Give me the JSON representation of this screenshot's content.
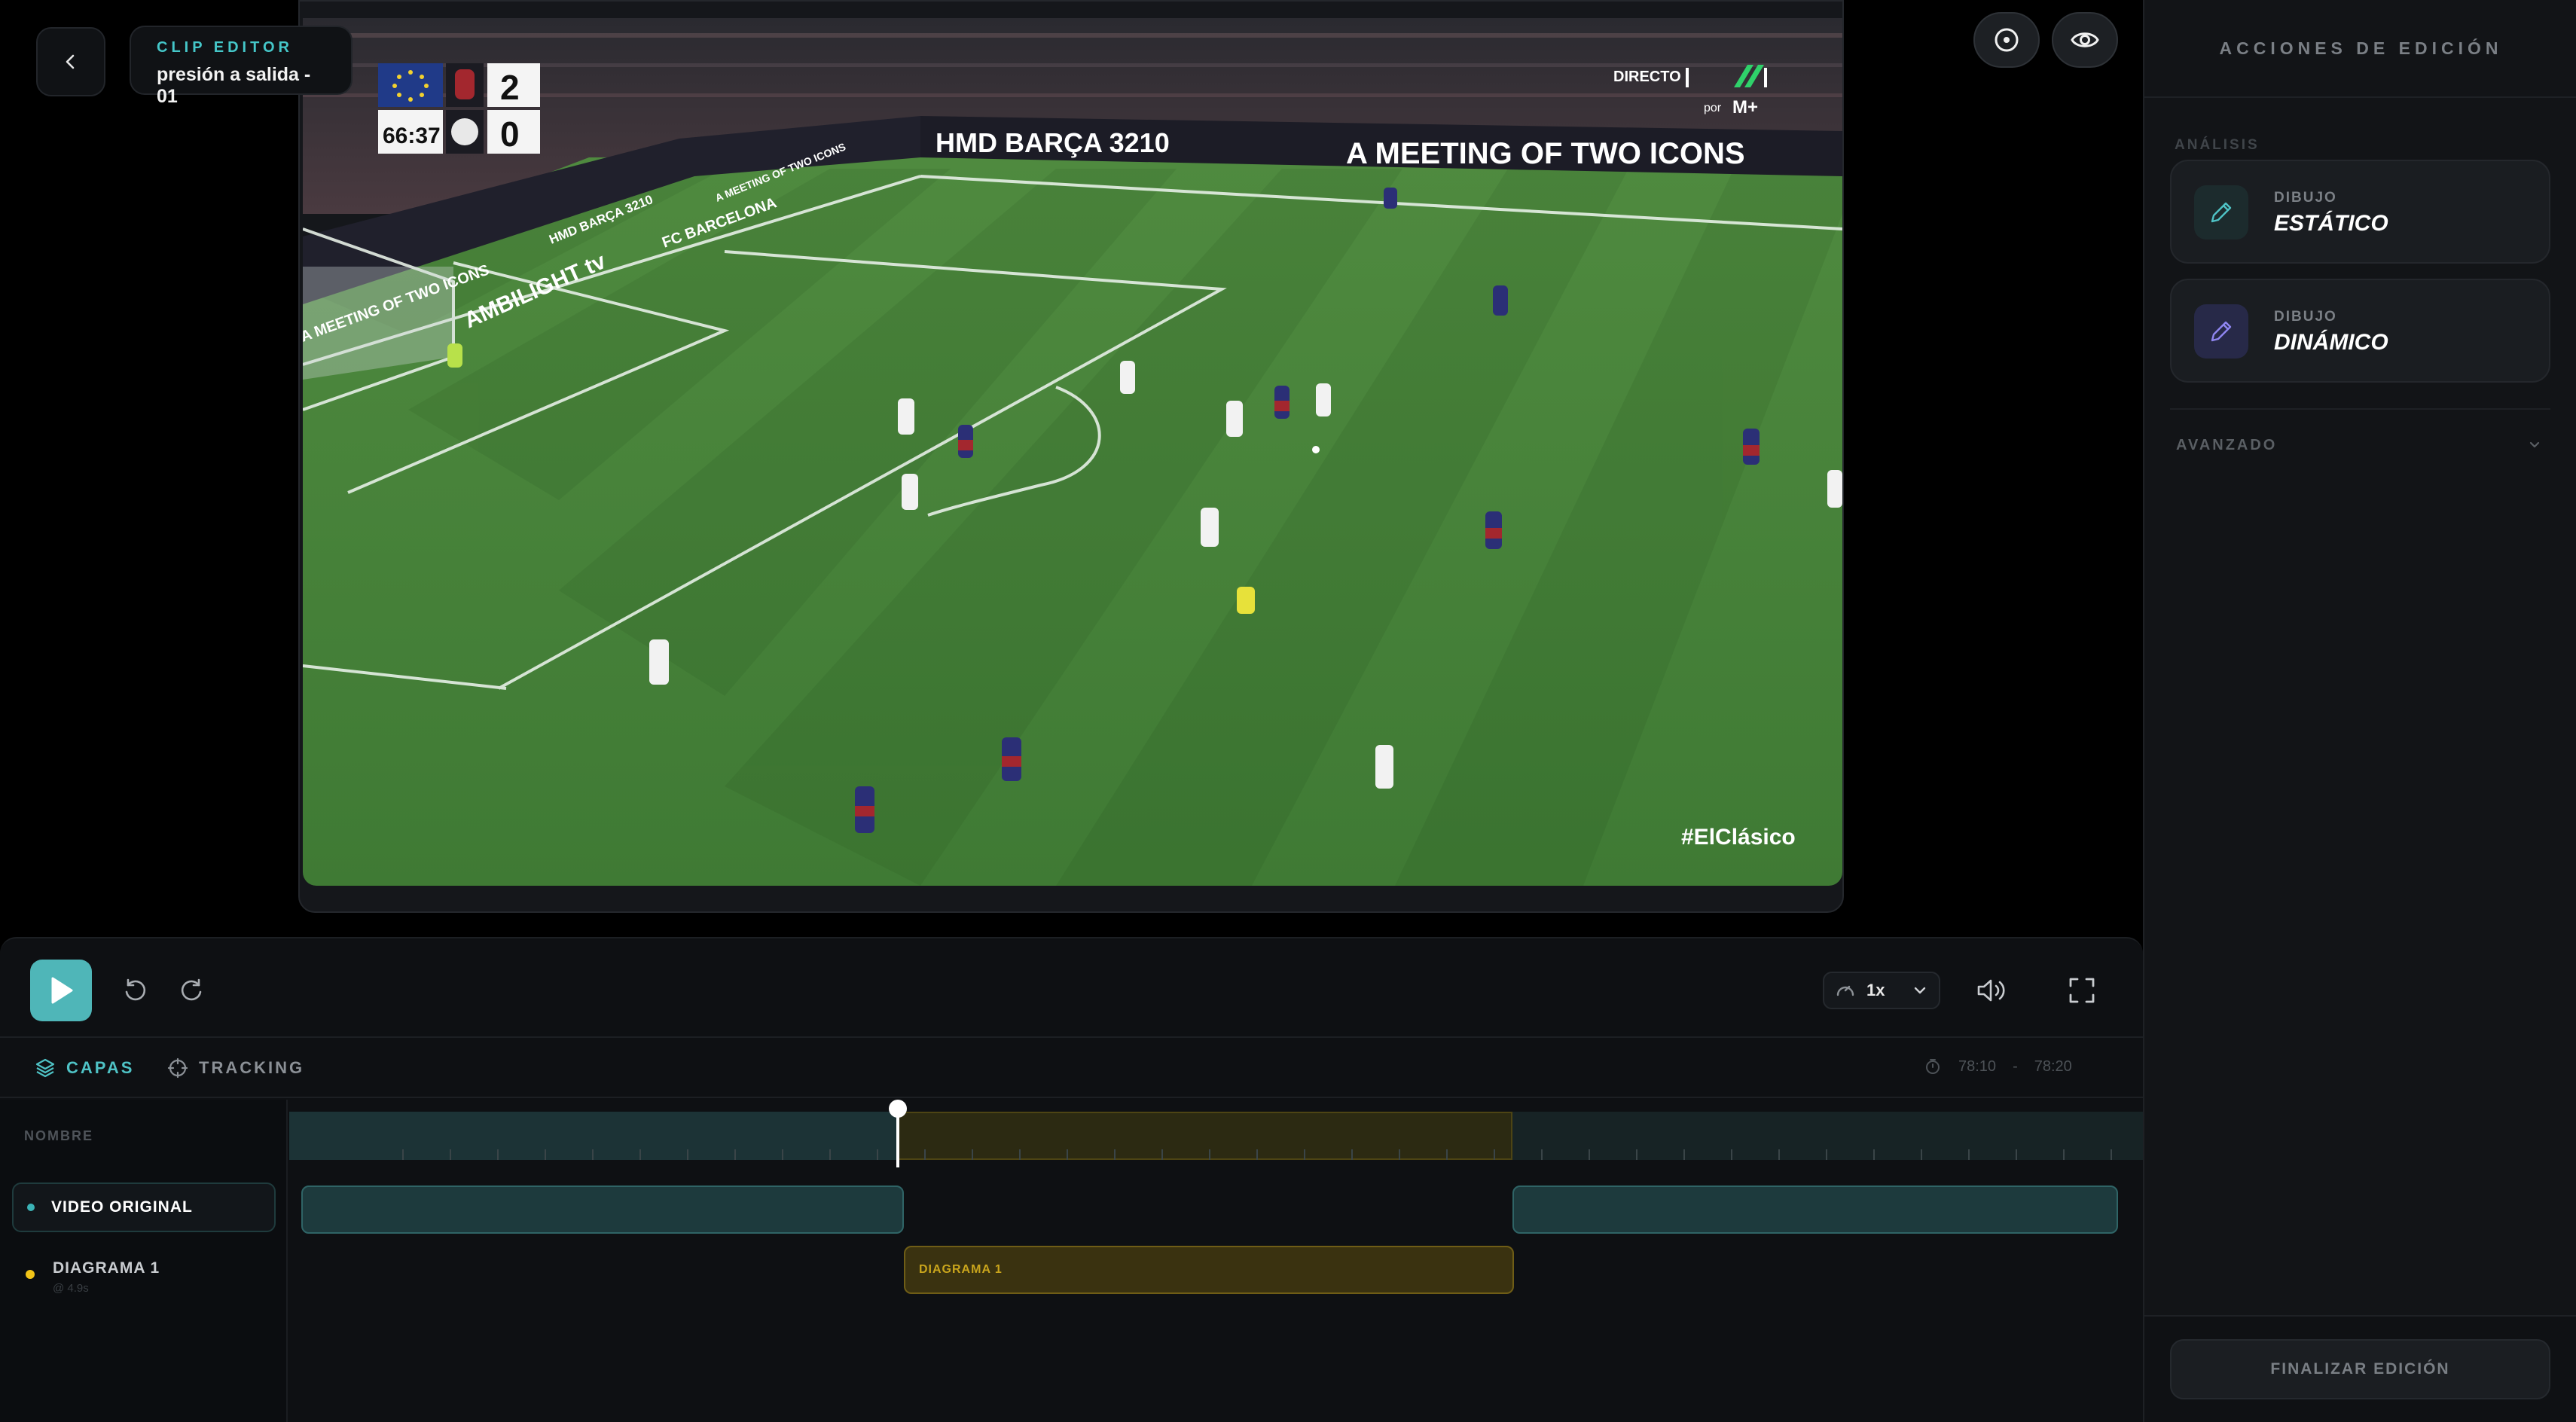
{
  "header": {
    "kicker": "CLIP EDITOR",
    "clip_name": "presión a salida - 01"
  },
  "broadcast": {
    "clock": "66:37",
    "score_home": "2",
    "score_away": "0",
    "live_label": "DIRECTO",
    "sponsor_label": "por",
    "hashtag": "#ElClásico",
    "board_left": "HMD BARÇA 3210",
    "board_right": "A MEETING OF TWO ICONS",
    "board_side_1": "AMBILIGHT tv",
    "board_side_2": "FC BARCELONA",
    "board_side_3": "HMD BARÇA 3210",
    "board_side_4": "A MEETING OF TWO ICONS",
    "board_side_5": "A MEETING OF TWO ICONS"
  },
  "playback": {
    "speed": "1x"
  },
  "layers": {
    "tab_layers": "CAPAS",
    "tab_tracking": "TRACKING",
    "time_start": "78:10",
    "time_separator": "-",
    "time_end": "78:20",
    "name_header": "NOMBRE",
    "rows": [
      {
        "label": "VIDEO ORIGINAL"
      },
      {
        "label": "DIAGRAMA 1",
        "sub": "@ 4.9s"
      }
    ],
    "clip_diagram_label": "DIAGRAMA 1"
  },
  "panel": {
    "title": "ACCIONES DE EDICIÓN",
    "section_analysis": "ANÁLISIS",
    "actions": [
      {
        "kicker": "DIBUJO",
        "title": "ESTÁTICO"
      },
      {
        "kicker": "DIBUJO",
        "title": "DINÁMICO"
      }
    ],
    "advanced": "AVANZADO",
    "finish": "FINALIZAR EDICIÓN"
  },
  "colors": {
    "accent": "#4fb6b8",
    "diagram": "#f2c418",
    "pitch": "#3f7a34"
  },
  "icons": [
    "chevron-left-icon",
    "target-icon",
    "eye-icon",
    "play-icon",
    "rewind-icon",
    "forward-icon",
    "speed-icon",
    "chevron-down-icon",
    "volume-icon",
    "fullscreen-icon",
    "layers-icon",
    "crosshair-icon",
    "timer-icon",
    "pencil-icon"
  ]
}
